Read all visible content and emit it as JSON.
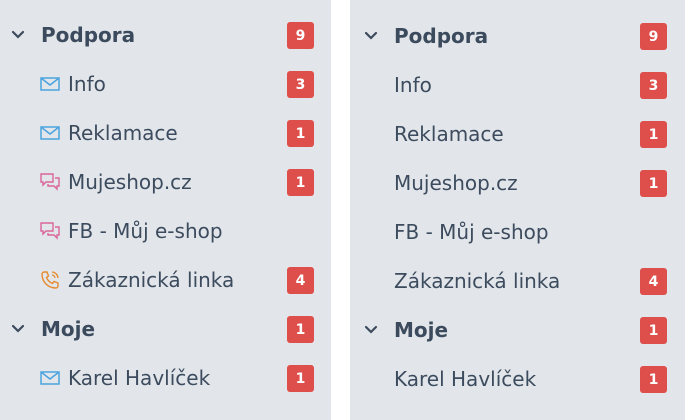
{
  "left_panel": {
    "groups": [
      {
        "label": "Podpora",
        "badge": "9",
        "items": [
          {
            "label": "Info",
            "badge": "3",
            "icon": "envelope-icon"
          },
          {
            "label": "Reklamace",
            "badge": "1",
            "icon": "envelope-icon"
          },
          {
            "label": "Mujeshop.cz",
            "badge": "1",
            "icon": "chat-icon"
          },
          {
            "label": "FB - Můj e-shop",
            "badge": "",
            "icon": "chat-icon"
          },
          {
            "label": "Zákaznická linka",
            "badge": "4",
            "icon": "phone-icon"
          }
        ]
      },
      {
        "label": "Moje",
        "badge": "1",
        "items": [
          {
            "label": "Karel Havlíček",
            "badge": "1",
            "icon": "envelope-icon"
          }
        ]
      }
    ]
  },
  "right_panel": {
    "groups": [
      {
        "label": "Podpora",
        "badge": "9",
        "items": [
          {
            "label": "Info",
            "badge": "3"
          },
          {
            "label": "Reklamace",
            "badge": "1"
          },
          {
            "label": "Mujeshop.cz",
            "badge": "1"
          },
          {
            "label": "FB - Můj e-shop",
            "badge": ""
          },
          {
            "label": "Zákaznická linka",
            "badge": "4"
          }
        ]
      },
      {
        "label": "Moje",
        "badge": "1",
        "items": [
          {
            "label": "Karel Havlíček",
            "badge": "1"
          }
        ]
      }
    ]
  },
  "colors": {
    "panel_bg": "#e2e6ea",
    "badge_bg": "#de4f4b",
    "text": "#3b4a5d",
    "envelope_icon": "#4aa3df",
    "chat_icon": "#d9669a",
    "phone_icon": "#e58a2e"
  }
}
